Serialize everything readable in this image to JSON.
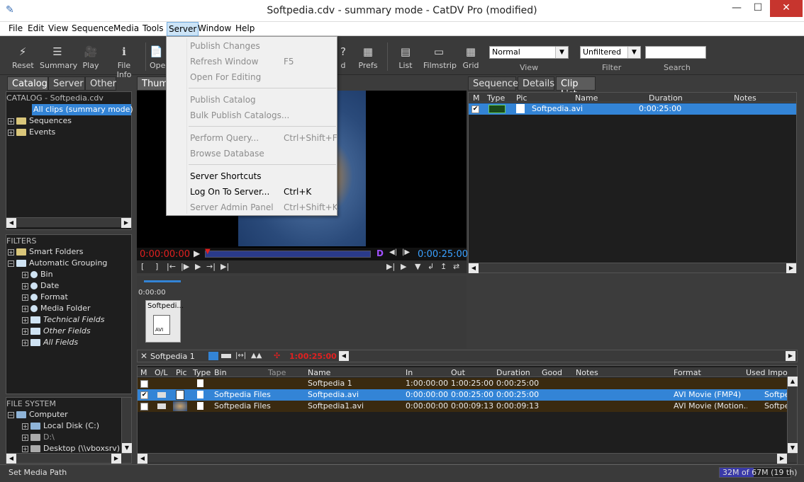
{
  "window": {
    "title": "Softpedia.cdv - summary mode - CatDV Pro (modified)",
    "minimize": "—",
    "maximize": "☐",
    "close": "✕"
  },
  "menubar": {
    "items": [
      "File",
      "Edit",
      "View",
      "Sequence",
      "Media",
      "Tools",
      "Server",
      "Window",
      "Help"
    ]
  },
  "toolbar": {
    "reset": "Reset",
    "summary": "Summary",
    "play": "Play",
    "file_info": "File Info",
    "open_partial": "Ope",
    "find_partial": "d",
    "prefs": "Prefs",
    "list": "List",
    "filmstrip": "Filmstrip",
    "grid": "Grid",
    "view_value": "Normal",
    "view_label": "View",
    "filter_value": "Unfiltered",
    "filter_label": "Filter",
    "search_value": "",
    "search_label": "Search"
  },
  "left_tabs": [
    "Catalog",
    "Server",
    "Other"
  ],
  "catalog": {
    "header": "CATALOG - Softpedia.cdv",
    "items": [
      "All clips (summary mode)",
      "Sequences",
      "Events"
    ]
  },
  "filters": {
    "header": "FILTERS",
    "items": [
      "Smart Folders",
      "Automatic Grouping",
      "Bin",
      "Date",
      "Format",
      "Media Folder",
      "Technical Fields",
      "Other Fields",
      "All Fields"
    ]
  },
  "file_system": {
    "header": "FILE SYSTEM",
    "items": [
      "Computer",
      "Local Disk (C:)",
      "D:\\",
      "Desktop (\\\\vboxsrv)"
    ]
  },
  "server_menu": {
    "items": [
      {
        "label": "Publish Changes",
        "shortcut": ""
      },
      {
        "label": "Refresh Window",
        "shortcut": "F5"
      },
      {
        "label": "Open For Editing",
        "shortcut": ""
      },
      {
        "label": "Publish Catalog",
        "shortcut": ""
      },
      {
        "label": "Bulk Publish Catalogs...",
        "shortcut": ""
      },
      {
        "label": "Perform Query...",
        "shortcut": "Ctrl+Shift+F"
      },
      {
        "label": "Browse Database",
        "shortcut": ""
      },
      {
        "label": "Server Shortcuts",
        "shortcut": ""
      },
      {
        "label": "Log On To Server...",
        "shortcut": "Ctrl+K"
      },
      {
        "label": "Server Admin Panel",
        "shortcut": "Ctrl+Shift+K"
      }
    ]
  },
  "center": {
    "tab_partial": "Thum",
    "timecode_in": "0:00:00:00",
    "timecode_out": "0:00:25:00",
    "d_label": "D",
    "strip_time": "0:00:00",
    "strip_clip_name": "Softpedi...",
    "strip_clip_type": "AVI"
  },
  "right_tabs": [
    "Sequence",
    "Details",
    "Clip List"
  ],
  "clip_list": {
    "columns": [
      "M",
      "Type",
      "Pic",
      "Name",
      "Duration",
      "Notes"
    ],
    "rows": [
      {
        "name": "Softpedia.avi",
        "duration": "0:00:25:00"
      }
    ]
  },
  "sequence_bar": {
    "name": "Softpedia 1",
    "time": "1:00:25:00"
  },
  "bottom_table": {
    "columns": [
      "M",
      "O/L",
      "Pic",
      "Type",
      "Bin",
      "Tape",
      "Name",
      "In",
      "Out",
      "Duration",
      "Good",
      "Notes",
      "Format",
      "Used Impo"
    ],
    "rows": [
      {
        "bin": "",
        "name": "Softpedia 1",
        "in": "1:00:00:00",
        "out": "1:00:25:00",
        "duration": "0:00:25:00",
        "format": "",
        "used": ""
      },
      {
        "bin": "Softpedia Files",
        "name": "Softpedia.avi",
        "in": "0:00:00:00",
        "out": "0:00:25:00",
        "duration": "0:00:25:00",
        "format": "AVI Movie (FMP4)",
        "used": "Softpe"
      },
      {
        "bin": "Softpedia Files",
        "name": "Softpedia1.avi",
        "in": "0:00:00:00",
        "out": "0:00:09:13",
        "duration": "0:00:09:13",
        "format": "AVI Movie (Motion...",
        "used": "Softpe"
      }
    ]
  },
  "status": {
    "left": "Set Media Path",
    "memory_used": "32M",
    "memory_rest": " of 67M (19 th)",
    "memory_fraction": 0.48
  },
  "colors": {
    "selection": "#3384d6",
    "timecode_red": "#e02020",
    "timecode_blue": "#3aa0ff",
    "menu_highlight": "#cce4f7"
  }
}
